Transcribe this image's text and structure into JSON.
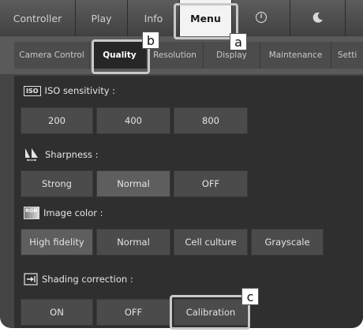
{
  "top_tabs": [
    {
      "label": "Controller"
    },
    {
      "label": "Play"
    },
    {
      "label": "Info"
    },
    {
      "label": "Menu"
    },
    {
      "label": "",
      "icon": "power-icon"
    },
    {
      "label": "",
      "icon": "moon-icon"
    }
  ],
  "sub_tabs": [
    {
      "label": "Camera Control"
    },
    {
      "label": "Quality"
    },
    {
      "label": "Resolution"
    },
    {
      "label": "Display"
    },
    {
      "label": "Maintenance"
    },
    {
      "label": "Setti"
    }
  ],
  "iso": {
    "icon_text": "ISO",
    "label": "ISO sensitivity :",
    "options": [
      "200",
      "400",
      "800"
    ]
  },
  "sharpness": {
    "label": "Sharpness :",
    "options": [
      "Strong",
      "Normal",
      "OFF"
    ],
    "selected": "Normal"
  },
  "image_color": {
    "icon_text": "RGB",
    "label": "Image color :",
    "options": [
      "High fidelity",
      "Normal",
      "Cell culture",
      "Grayscale"
    ],
    "selected": "High fidelity"
  },
  "shading": {
    "label": "Shading correction :",
    "options": [
      "ON",
      "OFF",
      "Calibration"
    ]
  },
  "callouts": {
    "a": "a",
    "b": "b",
    "c": "c"
  }
}
